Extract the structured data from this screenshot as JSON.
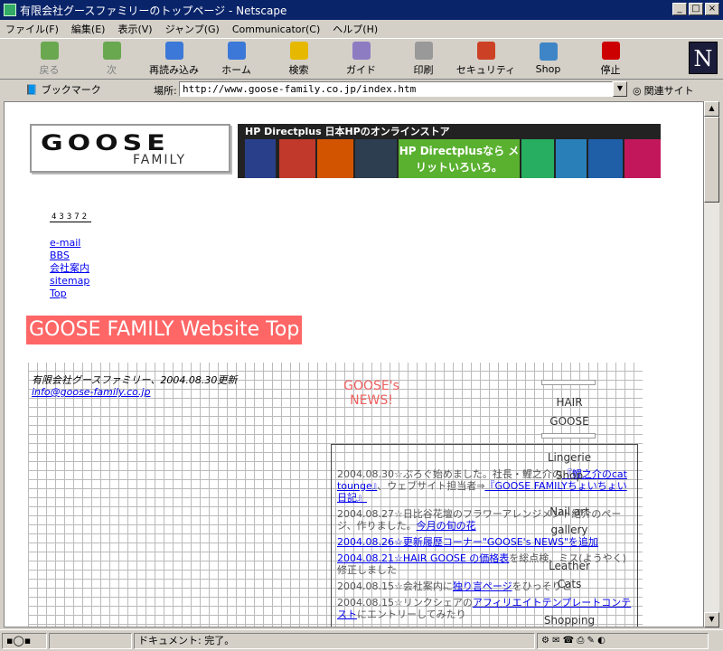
{
  "window": {
    "title": "有限会社グースファミリーのトップページ - Netscape",
    "min": "_",
    "max": "□",
    "close": "×"
  },
  "menu": [
    "ファイル(F)",
    "編集(E)",
    "表示(V)",
    "ジャンプ(G)",
    "Communicator(C)",
    "ヘルプ(H)"
  ],
  "toolbar": [
    {
      "label": "戻る",
      "icon": "back-icon",
      "color": "#6aa84f",
      "enabled": false
    },
    {
      "label": "次",
      "icon": "forward-icon",
      "color": "#6aa84f",
      "enabled": false
    },
    {
      "label": "再読み込み",
      "icon": "reload-icon",
      "color": "#3c78d8",
      "enabled": true
    },
    {
      "label": "ホーム",
      "icon": "home-icon",
      "color": "#3c78d8",
      "enabled": true
    },
    {
      "label": "検索",
      "icon": "search-icon",
      "color": "#e6b800",
      "enabled": true
    },
    {
      "label": "ガイド",
      "icon": "guide-icon",
      "color": "#8e7cc3",
      "enabled": true
    },
    {
      "label": "印刷",
      "icon": "print-icon",
      "color": "#999999",
      "enabled": true
    },
    {
      "label": "セキュリティ",
      "icon": "lock-icon",
      "color": "#cc4125",
      "enabled": true
    },
    {
      "label": "Shop",
      "icon": "shop-icon",
      "color": "#3d85c6",
      "enabled": true
    },
    {
      "label": "停止",
      "icon": "stop-icon",
      "color": "#cc0000",
      "enabled": true
    }
  ],
  "location": {
    "bookmarks": "ブックマーク",
    "label": "場所:",
    "url": "http://www.goose-family.co.jp/index.htm",
    "related": "関連サイト"
  },
  "page": {
    "logo_big": "GOOSE",
    "logo_small": "FAMILY",
    "banner_top": "HP Directplus  日本HPのオンラインストア",
    "banner_mid": "HP Directplusなら メリットいろいろ。",
    "counter": "43372",
    "nav": [
      "e-mail",
      "BBS",
      "会社案内",
      "sitemap",
      "Top"
    ],
    "heading": "GOOSE FAMILY Website Top",
    "updated": "有限会社グースファミリー、2004.08.30更新",
    "email": "info@goose-family.co.jp",
    "news_title": "GOOSE's NEWS!",
    "news": [
      {
        "pre": "2004.08.30☆ぷろぐ始めました。社長・鯉之介の",
        "link": "『鯉之介のcat tounge』",
        "post": "、ウェブサイト担当者⇒",
        "link2": "『GOOSE FAMILYちょいちょい日記』"
      },
      {
        "pre": "2004.08.27☆日比谷花壇のフラワーアレンジメント紹介のページ、作りました。",
        "link": "今月の旬の花",
        "post": ""
      },
      {
        "pre": "",
        "link": "2004.08.26☆更新履歴コーナー\"GOOSE's NEWS\"を追加",
        "post": ""
      },
      {
        "pre": "",
        "link": "2004.08.21☆HAIR GOOSE の価格表",
        "post": "を総点検、ミス(ようやく)修正しました"
      },
      {
        "pre": "2004.08.15☆会社案内に",
        "link": "独り言ページ",
        "post": "をひっそりと"
      },
      {
        "pre": "2004.08.15☆リンクシェアの",
        "link": "アフィリエイトテンプレートコンテスト",
        "post": "にエントリーしてみたり"
      }
    ],
    "shops": [
      "HAIR",
      "GOOSE",
      "Lingerie",
      "Shop",
      "Nail art",
      "gallery",
      "Leather",
      "Cats",
      "Shopping"
    ]
  },
  "status": {
    "text": "ドキュメント: 完了。"
  }
}
